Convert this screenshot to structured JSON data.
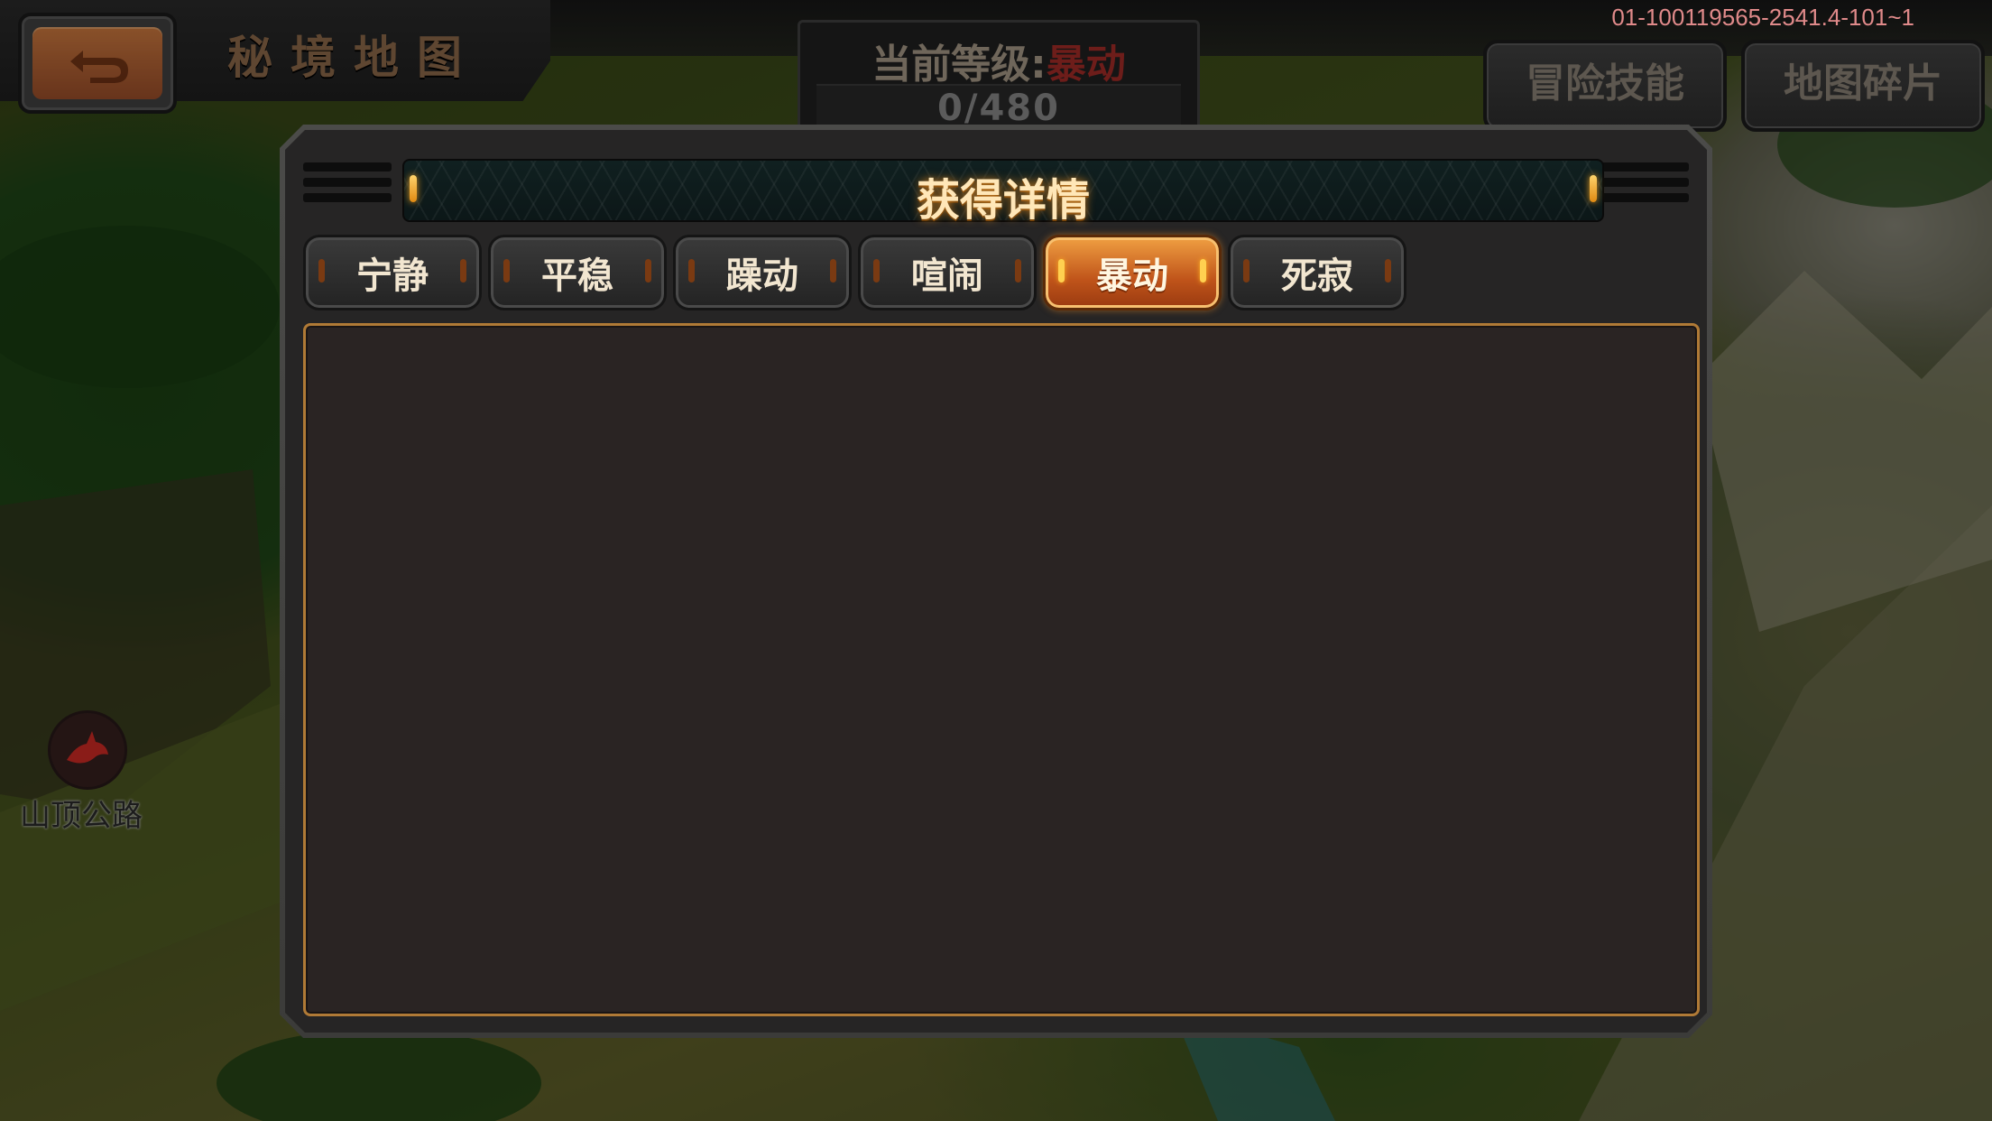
{
  "header": {
    "title": "秘境地图",
    "build_id": "01-100119565-2541.4-101~1"
  },
  "level": {
    "label": "当前等级:",
    "value": "暴动",
    "progress_text": "0/480"
  },
  "top_buttons": {
    "adventure_skills": "冒险技能",
    "map_fragments": "地图碎片"
  },
  "map": {
    "location_label": "山顶公路"
  },
  "dialog": {
    "title": "获得详情",
    "tabs": [
      {
        "label": "宁静",
        "active": false
      },
      {
        "label": "平稳",
        "active": false
      },
      {
        "label": "躁动",
        "active": false
      },
      {
        "label": "喧闹",
        "active": false
      },
      {
        "label": "暴动",
        "active": true
      },
      {
        "label": "死寂",
        "active": false
      }
    ]
  },
  "colors": {
    "accent_orange": "#e0761e",
    "level_value_red": "#6d1d1a",
    "content_border": "#b07a36"
  }
}
